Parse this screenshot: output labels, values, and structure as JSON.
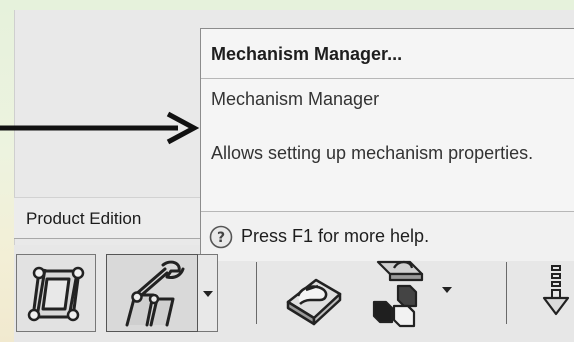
{
  "tooltip": {
    "title": "Mechanism Manager...",
    "name": "Mechanism Manager",
    "description": "Allows setting up mechanism properties.",
    "help": "Press F1 for more help."
  },
  "tabs": {
    "product_edition": "Product Edition"
  },
  "toolbar": {
    "icons": [
      "quad-mechanism-icon",
      "mechanism-manager-icon",
      "dropdown-arrow-icon",
      "hand-drag-icon",
      "assembly-cubes-icon",
      "dropdown-arrow-icon",
      "down-arrow-icon"
    ]
  }
}
